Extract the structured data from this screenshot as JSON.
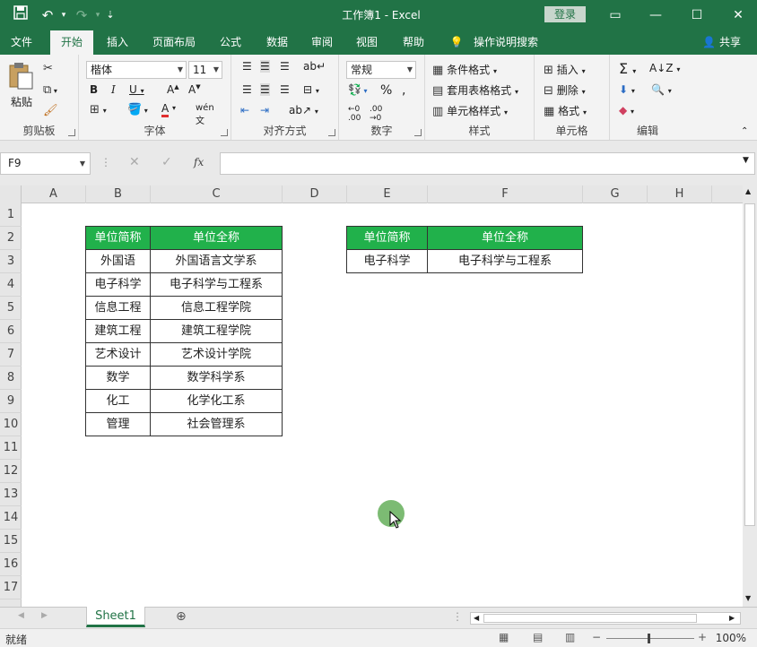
{
  "window": {
    "title": "工作簿1 - Excel",
    "login": "登录"
  },
  "menu": {
    "tabs": [
      "文件",
      "开始",
      "插入",
      "页面布局",
      "公式",
      "数据",
      "审阅",
      "视图",
      "帮助"
    ],
    "tell_me": "操作说明搜索",
    "share": "共享"
  },
  "ribbon": {
    "clipboard": {
      "label": "剪贴板",
      "paste": "粘贴"
    },
    "font": {
      "label": "字体",
      "name": "楷体",
      "size": "11"
    },
    "alignment": {
      "label": "对齐方式"
    },
    "number": {
      "label": "数字",
      "format": "常规"
    },
    "styles": {
      "label": "样式",
      "conditional": "条件格式",
      "table": "套用表格格式",
      "cell": "单元格样式"
    },
    "cells": {
      "label": "单元格",
      "insert": "插入",
      "delete": "删除",
      "format": "格式"
    },
    "editing": {
      "label": "编辑"
    }
  },
  "formula_bar": {
    "name_box": "F9",
    "fx": "fx",
    "value": ""
  },
  "grid": {
    "columns": [
      "A",
      "B",
      "C",
      "D",
      "E",
      "F",
      "G",
      "H"
    ],
    "rows": [
      "1",
      "2",
      "3",
      "4",
      "5",
      "6",
      "7",
      "8",
      "9",
      "10",
      "11",
      "12",
      "13",
      "14",
      "15",
      "16",
      "17"
    ]
  },
  "table1": {
    "headers": [
      "单位简称",
      "单位全称"
    ],
    "rows": [
      [
        "外国语",
        "外国语言文学系"
      ],
      [
        "电子科学",
        "电子科学与工程系"
      ],
      [
        "信息工程",
        "信息工程学院"
      ],
      [
        "建筑工程",
        "建筑工程学院"
      ],
      [
        "艺术设计",
        "艺术设计学院"
      ],
      [
        "数学",
        "数学科学系"
      ],
      [
        "化工",
        "化学化工系"
      ],
      [
        "管理",
        "社会管理系"
      ]
    ]
  },
  "table2": {
    "headers": [
      "单位简称",
      "单位全称"
    ],
    "rows": [
      [
        "电子科学",
        "电子科学与工程系"
      ]
    ]
  },
  "sheets": {
    "active": "Sheet1"
  },
  "status": {
    "text": "就绪",
    "zoom": "100%"
  },
  "colors": {
    "brand": "#217346",
    "header_fill": "#21b14b"
  }
}
